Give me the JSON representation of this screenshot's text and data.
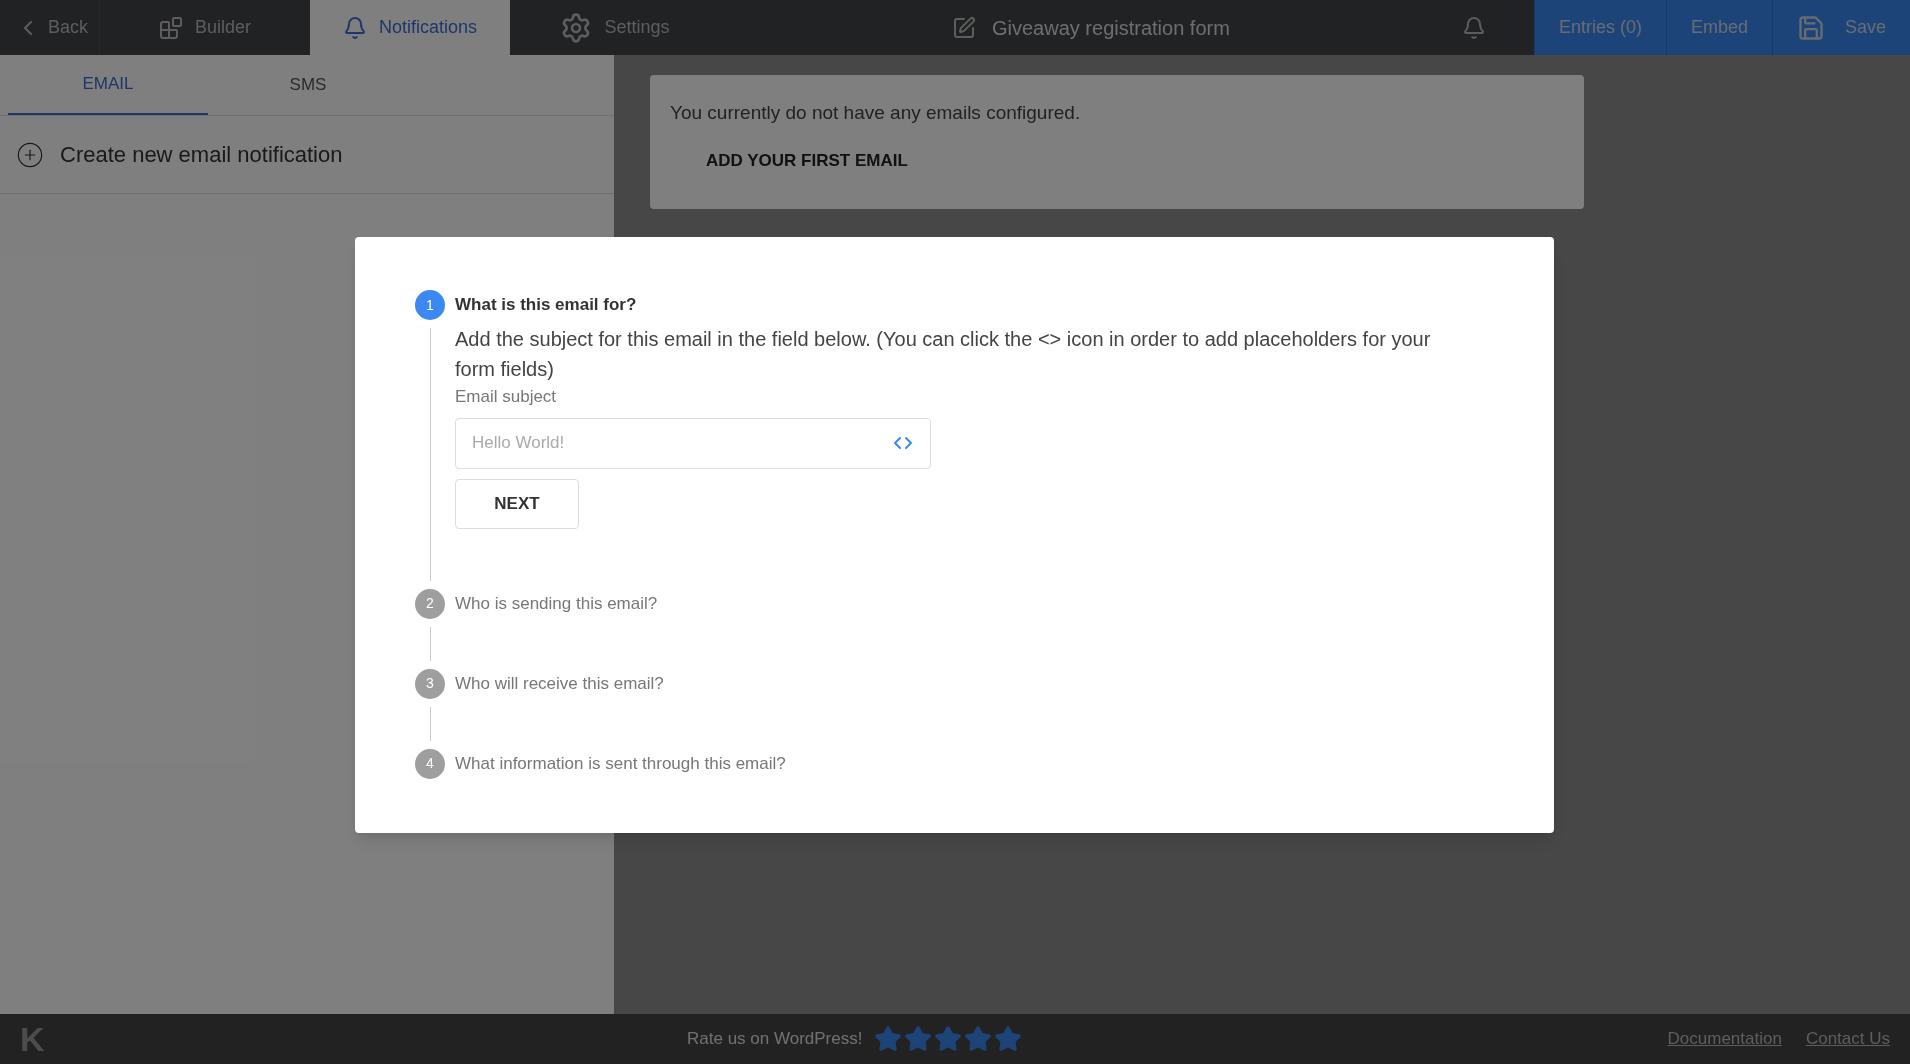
{
  "top_bar": {
    "back": "Back",
    "tabs": [
      {
        "label": "Builder",
        "kind": "blocks",
        "selected": false
      },
      {
        "label": "Notifications",
        "kind": "bell",
        "selected": true
      },
      {
        "label": "Settings",
        "kind": "gear",
        "selected": false
      }
    ],
    "form_title": "Giveaway registration form",
    "actions": [
      {
        "label": "Entries (0)",
        "kind": "plain"
      },
      {
        "label": "Embed",
        "kind": "plain"
      },
      {
        "label": "Save",
        "kind": "save"
      }
    ]
  },
  "sidebar": {
    "tabs": [
      {
        "label": "EMAIL",
        "selected": true
      },
      {
        "label": "SMS",
        "selected": false
      }
    ],
    "create": "Create new email notification"
  },
  "notice": {
    "text": "You currently do not have any emails configured.",
    "button": "ADD YOUR FIRST EMAIL"
  },
  "modal": {
    "steps": [
      {
        "number": "1",
        "title": "What is this email for?",
        "active": true,
        "description": "Add the subject for this email in the field below. (You can click the <> icon in order to add placeholders for your form fields)",
        "field_label": "Email subject",
        "placeholder": "Hello World!",
        "button": "NEXT"
      },
      {
        "number": "2",
        "title": "Who is sending this email?",
        "active": false
      },
      {
        "number": "3",
        "title": "Who will receive this email?",
        "active": false
      },
      {
        "number": "4",
        "title": "What information is sent through this email?",
        "active": false
      }
    ]
  },
  "footer": {
    "logo": "K",
    "rate": "Rate us on WordPress!",
    "stars": 5,
    "links": [
      "Documentation",
      "Contact Us"
    ]
  }
}
